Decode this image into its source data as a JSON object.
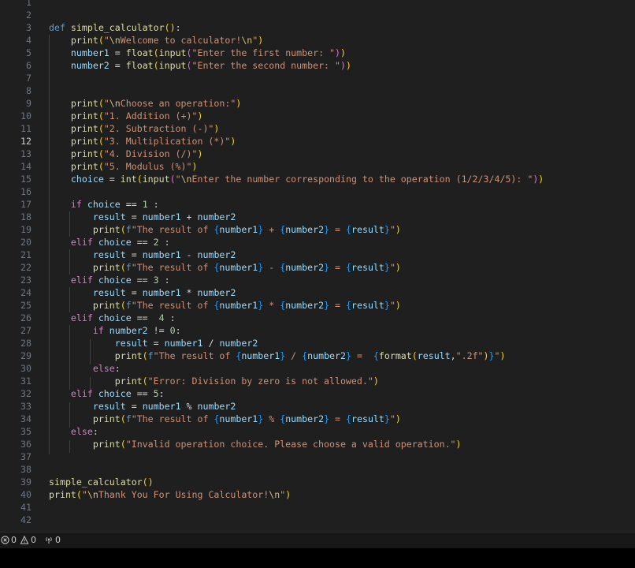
{
  "editor": {
    "active_line": 12,
    "lines": [
      {
        "n": "1",
        "t": []
      },
      {
        "n": "2",
        "t": []
      },
      {
        "n": "3",
        "t": [
          [
            "kw",
            "def "
          ],
          [
            "fn",
            "simple_calculator"
          ],
          [
            "p1",
            "()"
          ],
          [
            "op",
            ":"
          ]
        ]
      },
      {
        "n": "4",
        "t": [
          [
            "op",
            "    "
          ],
          [
            "fn",
            "print"
          ],
          [
            "p1",
            "("
          ],
          [
            "str",
            "\""
          ],
          [
            "esc",
            "\\n"
          ],
          [
            "str",
            "Welcome to calculator!"
          ],
          [
            "esc",
            "\\n"
          ],
          [
            "str",
            "\""
          ],
          [
            "p1",
            ")"
          ]
        ]
      },
      {
        "n": "5",
        "t": [
          [
            "op",
            "    "
          ],
          [
            "var",
            "number1"
          ],
          [
            "op",
            " = "
          ],
          [
            "fn",
            "float"
          ],
          [
            "p1",
            "("
          ],
          [
            "fn",
            "input"
          ],
          [
            "p2",
            "("
          ],
          [
            "str",
            "\"Enter the first number: \""
          ],
          [
            "p2",
            ")"
          ],
          [
            "p1",
            ")"
          ]
        ]
      },
      {
        "n": "6",
        "t": [
          [
            "op",
            "    "
          ],
          [
            "var",
            "number2"
          ],
          [
            "op",
            " = "
          ],
          [
            "fn",
            "float"
          ],
          [
            "p1",
            "("
          ],
          [
            "fn",
            "input"
          ],
          [
            "p2",
            "("
          ],
          [
            "str",
            "\"Enter the second number: \""
          ],
          [
            "p2",
            ")"
          ],
          [
            "p1",
            ")"
          ]
        ]
      },
      {
        "n": "7",
        "t": []
      },
      {
        "n": "8",
        "t": []
      },
      {
        "n": "9",
        "t": [
          [
            "op",
            "    "
          ],
          [
            "fn",
            "print"
          ],
          [
            "p1",
            "("
          ],
          [
            "str",
            "\""
          ],
          [
            "esc",
            "\\n"
          ],
          [
            "str",
            "Choose an operation:\""
          ],
          [
            "p1",
            ")"
          ]
        ]
      },
      {
        "n": "10",
        "t": [
          [
            "op",
            "    "
          ],
          [
            "fn",
            "print"
          ],
          [
            "p1",
            "("
          ],
          [
            "str",
            "\"1. Addition (+)\""
          ],
          [
            "p1",
            ")"
          ]
        ]
      },
      {
        "n": "11",
        "t": [
          [
            "op",
            "    "
          ],
          [
            "fn",
            "print"
          ],
          [
            "p1",
            "("
          ],
          [
            "str",
            "\"2. Subtraction (-)\""
          ],
          [
            "p1",
            ")"
          ]
        ]
      },
      {
        "n": "12",
        "t": [
          [
            "op",
            "    "
          ],
          [
            "fn",
            "print"
          ],
          [
            "p1",
            "("
          ],
          [
            "str",
            "\"3. Multiplication (*)\""
          ],
          [
            "p1",
            ")"
          ]
        ]
      },
      {
        "n": "13",
        "t": [
          [
            "op",
            "    "
          ],
          [
            "fn",
            "print"
          ],
          [
            "p1",
            "("
          ],
          [
            "str",
            "\"4. Division (/)\""
          ],
          [
            "p1",
            ")"
          ]
        ]
      },
      {
        "n": "14",
        "t": [
          [
            "op",
            "    "
          ],
          [
            "fn",
            "print"
          ],
          [
            "p1",
            "("
          ],
          [
            "str",
            "\"5. Modulus (%)\""
          ],
          [
            "p1",
            ")"
          ]
        ]
      },
      {
        "n": "15",
        "t": [
          [
            "op",
            "    "
          ],
          [
            "var",
            "choice"
          ],
          [
            "op",
            " = "
          ],
          [
            "fn",
            "int"
          ],
          [
            "p1",
            "("
          ],
          [
            "fn",
            "input"
          ],
          [
            "p2",
            "("
          ],
          [
            "str",
            "\""
          ],
          [
            "esc",
            "\\n"
          ],
          [
            "str",
            "Enter the number corresponding to the operation (1/2/3/4/5): \""
          ],
          [
            "p2",
            ")"
          ],
          [
            "p1",
            ")"
          ]
        ]
      },
      {
        "n": "16",
        "t": []
      },
      {
        "n": "17",
        "t": [
          [
            "op",
            "    "
          ],
          [
            "ctl",
            "if "
          ],
          [
            "var",
            "choice"
          ],
          [
            "op",
            " == "
          ],
          [
            "num",
            "1"
          ],
          [
            "op",
            " :"
          ]
        ]
      },
      {
        "n": "18",
        "t": [
          [
            "op",
            "        "
          ],
          [
            "var",
            "result"
          ],
          [
            "op",
            " = "
          ],
          [
            "var",
            "number1"
          ],
          [
            "op",
            " + "
          ],
          [
            "var",
            "number2"
          ]
        ]
      },
      {
        "n": "19",
        "t": [
          [
            "op",
            "        "
          ],
          [
            "fn",
            "print"
          ],
          [
            "p1",
            "("
          ],
          [
            "kw",
            "f"
          ],
          [
            "str",
            "\"The result of "
          ],
          [
            "p3",
            "{"
          ],
          [
            "var",
            "number1"
          ],
          [
            "p3",
            "}"
          ],
          [
            "str",
            " + "
          ],
          [
            "p3",
            "{"
          ],
          [
            "var",
            "number2"
          ],
          [
            "p3",
            "}"
          ],
          [
            "str",
            " = "
          ],
          [
            "p3",
            "{"
          ],
          [
            "var",
            "result"
          ],
          [
            "p3",
            "}"
          ],
          [
            "str",
            "\""
          ],
          [
            "p1",
            ")"
          ]
        ]
      },
      {
        "n": "20",
        "t": [
          [
            "op",
            "    "
          ],
          [
            "ctl",
            "elif "
          ],
          [
            "var",
            "choice"
          ],
          [
            "op",
            " == "
          ],
          [
            "num",
            "2"
          ],
          [
            "op",
            " :"
          ]
        ]
      },
      {
        "n": "21",
        "t": [
          [
            "op",
            "        "
          ],
          [
            "var",
            "result"
          ],
          [
            "op",
            " = "
          ],
          [
            "var",
            "number1"
          ],
          [
            "op",
            " - "
          ],
          [
            "var",
            "number2"
          ]
        ]
      },
      {
        "n": "22",
        "t": [
          [
            "op",
            "        "
          ],
          [
            "fn",
            "print"
          ],
          [
            "p1",
            "("
          ],
          [
            "kw",
            "f"
          ],
          [
            "str",
            "\"The result of "
          ],
          [
            "p3",
            "{"
          ],
          [
            "var",
            "number1"
          ],
          [
            "p3",
            "}"
          ],
          [
            "str",
            " - "
          ],
          [
            "p3",
            "{"
          ],
          [
            "var",
            "number2"
          ],
          [
            "p3",
            "}"
          ],
          [
            "str",
            " = "
          ],
          [
            "p3",
            "{"
          ],
          [
            "var",
            "result"
          ],
          [
            "p3",
            "}"
          ],
          [
            "str",
            "\""
          ],
          [
            "p1",
            ")"
          ]
        ]
      },
      {
        "n": "23",
        "t": [
          [
            "op",
            "    "
          ],
          [
            "ctl",
            "elif "
          ],
          [
            "var",
            "choice"
          ],
          [
            "op",
            " == "
          ],
          [
            "num",
            "3"
          ],
          [
            "op",
            " :"
          ]
        ]
      },
      {
        "n": "24",
        "t": [
          [
            "op",
            "        "
          ],
          [
            "var",
            "result"
          ],
          [
            "op",
            " = "
          ],
          [
            "var",
            "number1"
          ],
          [
            "op",
            " * "
          ],
          [
            "var",
            "number2"
          ]
        ]
      },
      {
        "n": "25",
        "t": [
          [
            "op",
            "        "
          ],
          [
            "fn",
            "print"
          ],
          [
            "p1",
            "("
          ],
          [
            "kw",
            "f"
          ],
          [
            "str",
            "\"The result of "
          ],
          [
            "p3",
            "{"
          ],
          [
            "var",
            "number1"
          ],
          [
            "p3",
            "}"
          ],
          [
            "str",
            " * "
          ],
          [
            "p3",
            "{"
          ],
          [
            "var",
            "number2"
          ],
          [
            "p3",
            "}"
          ],
          [
            "str",
            " = "
          ],
          [
            "p3",
            "{"
          ],
          [
            "var",
            "result"
          ],
          [
            "p3",
            "}"
          ],
          [
            "str",
            "\""
          ],
          [
            "p1",
            ")"
          ]
        ]
      },
      {
        "n": "26",
        "t": [
          [
            "op",
            "    "
          ],
          [
            "ctl",
            "elif "
          ],
          [
            "var",
            "choice"
          ],
          [
            "op",
            " ==  "
          ],
          [
            "num",
            "4"
          ],
          [
            "op",
            " :"
          ]
        ]
      },
      {
        "n": "27",
        "t": [
          [
            "op",
            "        "
          ],
          [
            "ctl",
            "if "
          ],
          [
            "var",
            "number2"
          ],
          [
            "op",
            " != "
          ],
          [
            "num",
            "0"
          ],
          [
            "op",
            ":"
          ]
        ]
      },
      {
        "n": "28",
        "t": [
          [
            "op",
            "            "
          ],
          [
            "var",
            "result"
          ],
          [
            "op",
            " = "
          ],
          [
            "var",
            "number1"
          ],
          [
            "op",
            " / "
          ],
          [
            "var",
            "number2"
          ]
        ]
      },
      {
        "n": "29",
        "t": [
          [
            "op",
            "            "
          ],
          [
            "fn",
            "print"
          ],
          [
            "p1",
            "("
          ],
          [
            "kw",
            "f"
          ],
          [
            "str",
            "\"The result of "
          ],
          [
            "p3",
            "{"
          ],
          [
            "var",
            "number1"
          ],
          [
            "p3",
            "}"
          ],
          [
            "str",
            " / "
          ],
          [
            "p3",
            "{"
          ],
          [
            "var",
            "number2"
          ],
          [
            "p3",
            "}"
          ],
          [
            "str",
            " =  "
          ],
          [
            "p3",
            "{"
          ],
          [
            "fn",
            "format"
          ],
          [
            "p1",
            "("
          ],
          [
            "var",
            "result"
          ],
          [
            "op",
            ","
          ],
          [
            "str",
            "\".2f\""
          ],
          [
            "p1",
            ")"
          ],
          [
            "p3",
            "}"
          ],
          [
            "str",
            "\""
          ],
          [
            "p1",
            ")"
          ]
        ]
      },
      {
        "n": "30",
        "t": [
          [
            "op",
            "        "
          ],
          [
            "ctl",
            "else"
          ],
          [
            "op",
            ":"
          ]
        ]
      },
      {
        "n": "31",
        "t": [
          [
            "op",
            "            "
          ],
          [
            "fn",
            "print"
          ],
          [
            "p1",
            "("
          ],
          [
            "str",
            "\"Error: Division by zero is not allowed.\""
          ],
          [
            "p1",
            ")"
          ]
        ]
      },
      {
        "n": "32",
        "t": [
          [
            "op",
            "    "
          ],
          [
            "ctl",
            "elif "
          ],
          [
            "var",
            "choice"
          ],
          [
            "op",
            " == "
          ],
          [
            "num",
            "5"
          ],
          [
            "op",
            ":"
          ]
        ]
      },
      {
        "n": "33",
        "t": [
          [
            "op",
            "        "
          ],
          [
            "var",
            "result"
          ],
          [
            "op",
            " = "
          ],
          [
            "var",
            "number1"
          ],
          [
            "op",
            " % "
          ],
          [
            "var",
            "number2"
          ]
        ]
      },
      {
        "n": "34",
        "t": [
          [
            "op",
            "        "
          ],
          [
            "fn",
            "print"
          ],
          [
            "p1",
            "("
          ],
          [
            "kw",
            "f"
          ],
          [
            "str",
            "\"The result of "
          ],
          [
            "p3",
            "{"
          ],
          [
            "var",
            "number1"
          ],
          [
            "p3",
            "}"
          ],
          [
            "str",
            " % "
          ],
          [
            "p3",
            "{"
          ],
          [
            "var",
            "number2"
          ],
          [
            "p3",
            "}"
          ],
          [
            "str",
            " = "
          ],
          [
            "p3",
            "{"
          ],
          [
            "var",
            "result"
          ],
          [
            "p3",
            "}"
          ],
          [
            "str",
            "\""
          ],
          [
            "p1",
            ")"
          ]
        ]
      },
      {
        "n": "35",
        "t": [
          [
            "op",
            "    "
          ],
          [
            "ctl",
            "else"
          ],
          [
            "op",
            ":"
          ]
        ]
      },
      {
        "n": "36",
        "t": [
          [
            "op",
            "        "
          ],
          [
            "fn",
            "print"
          ],
          [
            "p1",
            "("
          ],
          [
            "str",
            "\"Invalid operation choice. Please choose a valid operation.\""
          ],
          [
            "p1",
            ")"
          ]
        ]
      },
      {
        "n": "37",
        "t": []
      },
      {
        "n": "38",
        "t": []
      },
      {
        "n": "39",
        "t": [
          [
            "fn",
            "simple_calculator"
          ],
          [
            "p1",
            "()"
          ]
        ]
      },
      {
        "n": "40",
        "t": [
          [
            "fn",
            "print"
          ],
          [
            "p1",
            "("
          ],
          [
            "str",
            "\""
          ],
          [
            "esc",
            "\\n"
          ],
          [
            "str",
            "Thank You For Using Calculator!"
          ],
          [
            "esc",
            "\\n"
          ],
          [
            "str",
            "\""
          ],
          [
            "p1",
            ")"
          ]
        ]
      },
      {
        "n": "41",
        "t": []
      },
      {
        "n": "42",
        "t": []
      }
    ]
  },
  "statusbar": {
    "errors_count": "0",
    "warnings_count": "0",
    "ports_count": "0",
    "icons": [
      "error-circle-icon",
      "warning-triangle-icon",
      "broadcast-icon"
    ]
  }
}
